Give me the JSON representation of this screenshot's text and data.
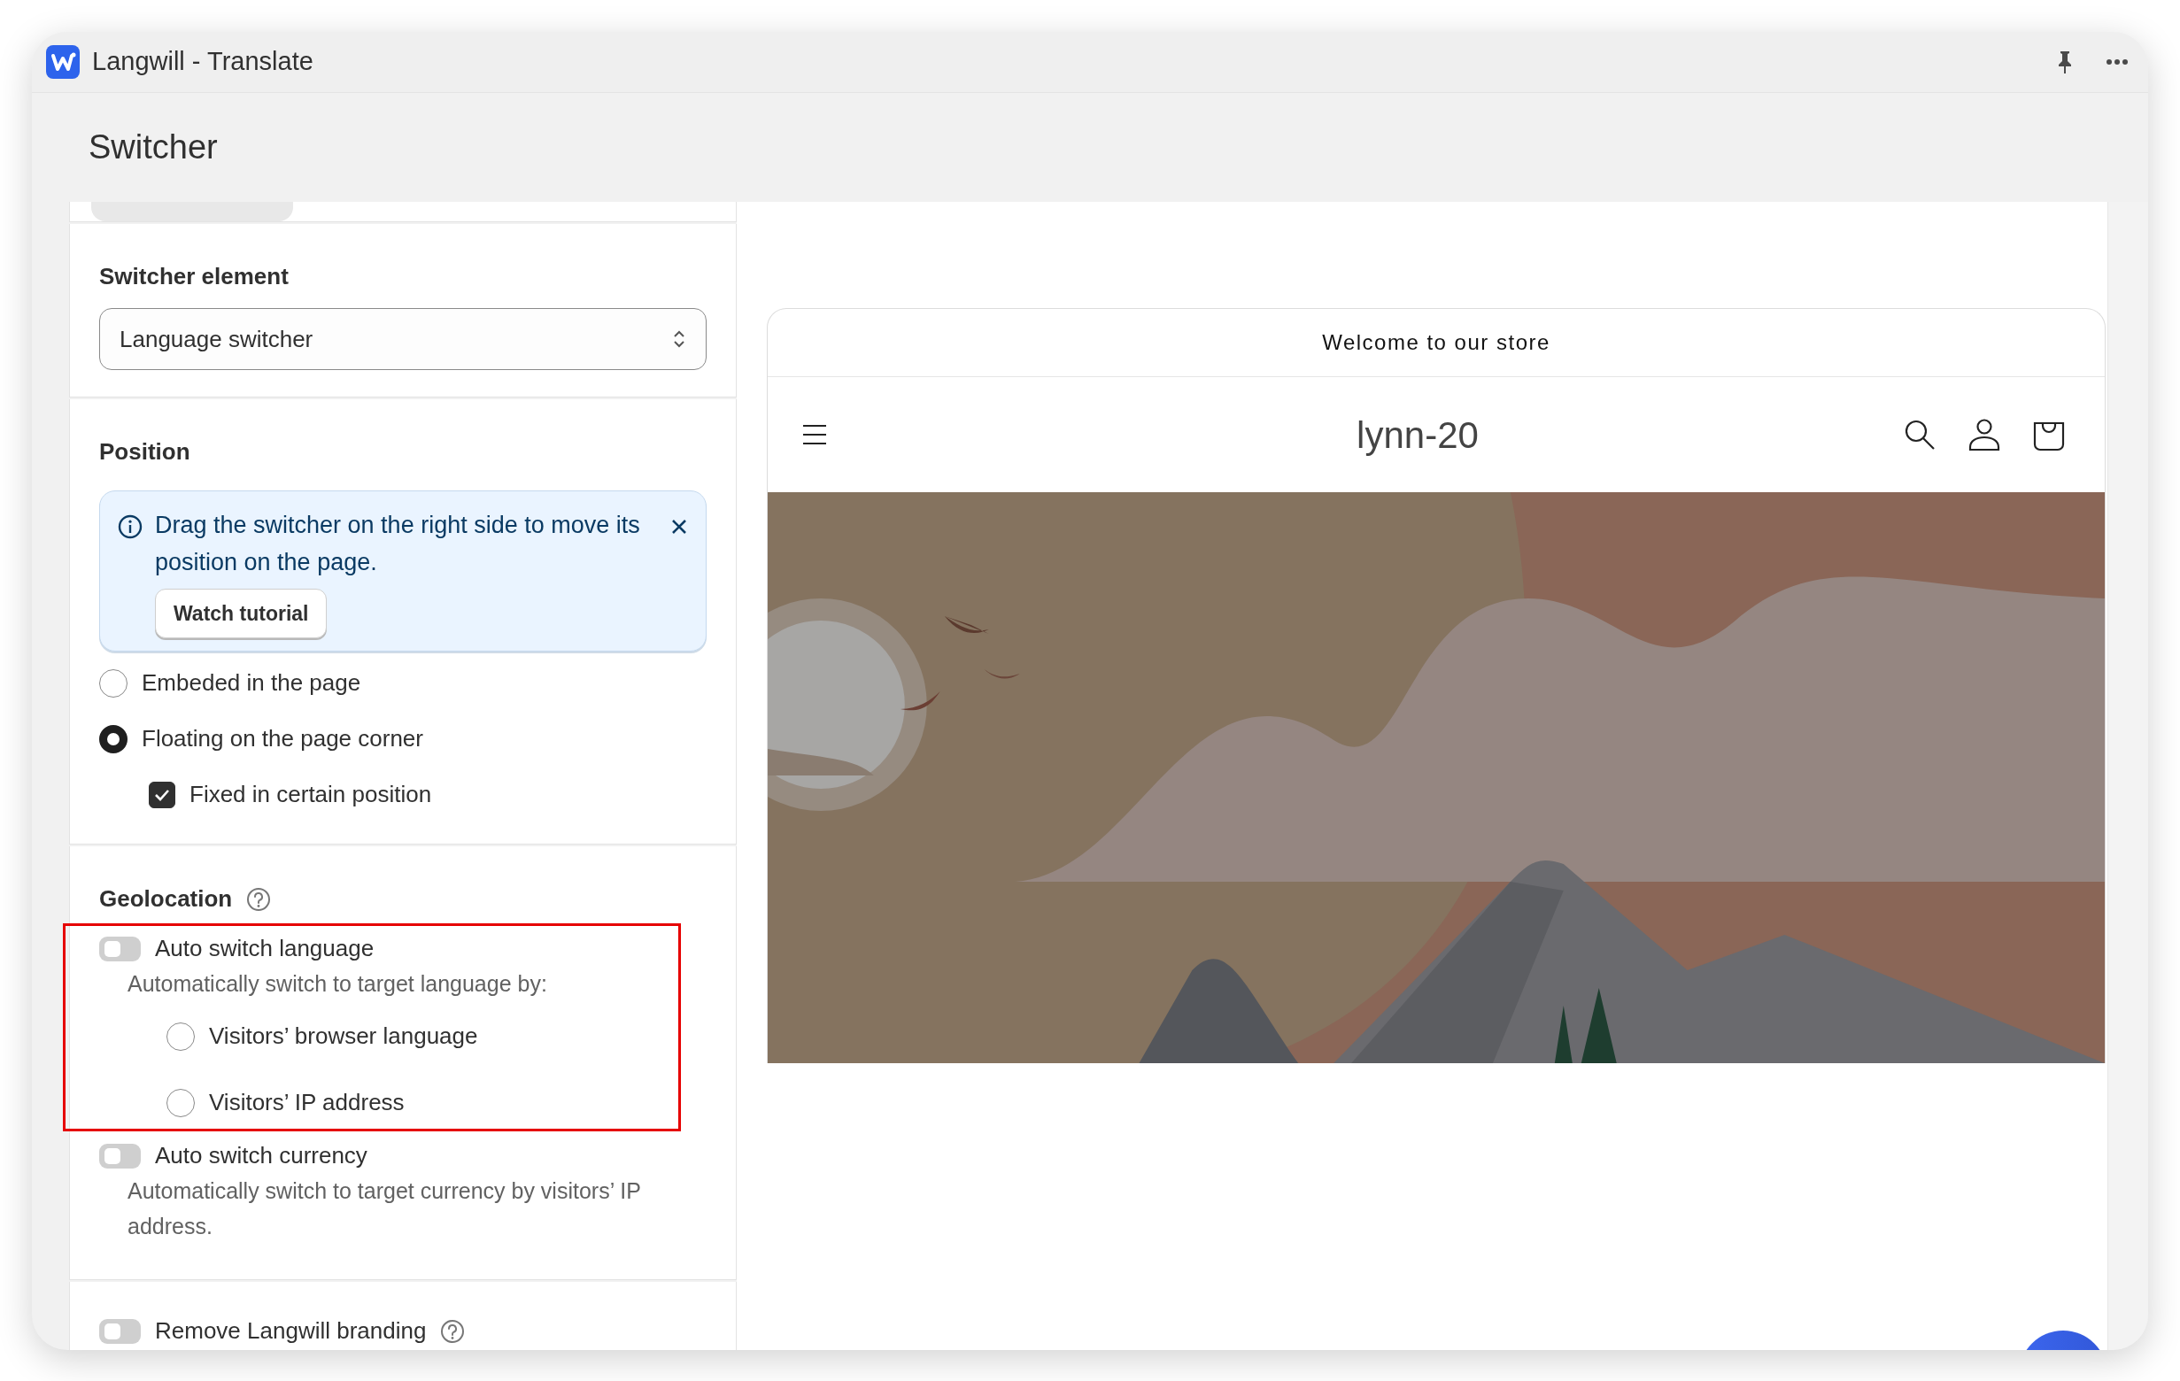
{
  "window": {
    "title": "Langwill - Translate"
  },
  "page": {
    "title": "Switcher"
  },
  "switcher_element": {
    "heading": "Switcher element",
    "value": "Language switcher"
  },
  "position": {
    "heading": "Position",
    "banner": {
      "text": "Drag the switcher on the right side to move its position on the page.",
      "button": "Watch tutorial"
    },
    "options": [
      {
        "label": "Embeded in the page",
        "selected": false
      },
      {
        "label": "Floating on the page corner",
        "selected": true
      }
    ],
    "fixed": {
      "label": "Fixed in certain position",
      "checked": true
    }
  },
  "geolocation": {
    "heading": "Geolocation",
    "auto_language": {
      "label": "Auto switch language",
      "on": false,
      "highlighted": true,
      "description": "Automatically switch to target language by:",
      "options": [
        {
          "label": "Visitors’ browser language",
          "selected": false
        },
        {
          "label": "Visitors’ IP address",
          "selected": false
        }
      ]
    },
    "auto_currency": {
      "label": "Auto switch currency",
      "on": false,
      "description": "Automatically switch to target currency by visitors’ IP address."
    }
  },
  "branding": {
    "label": "Remove Langwill branding",
    "on": false
  },
  "preview": {
    "announcement": "Welcome to our store",
    "store_name": "lynn-20"
  }
}
